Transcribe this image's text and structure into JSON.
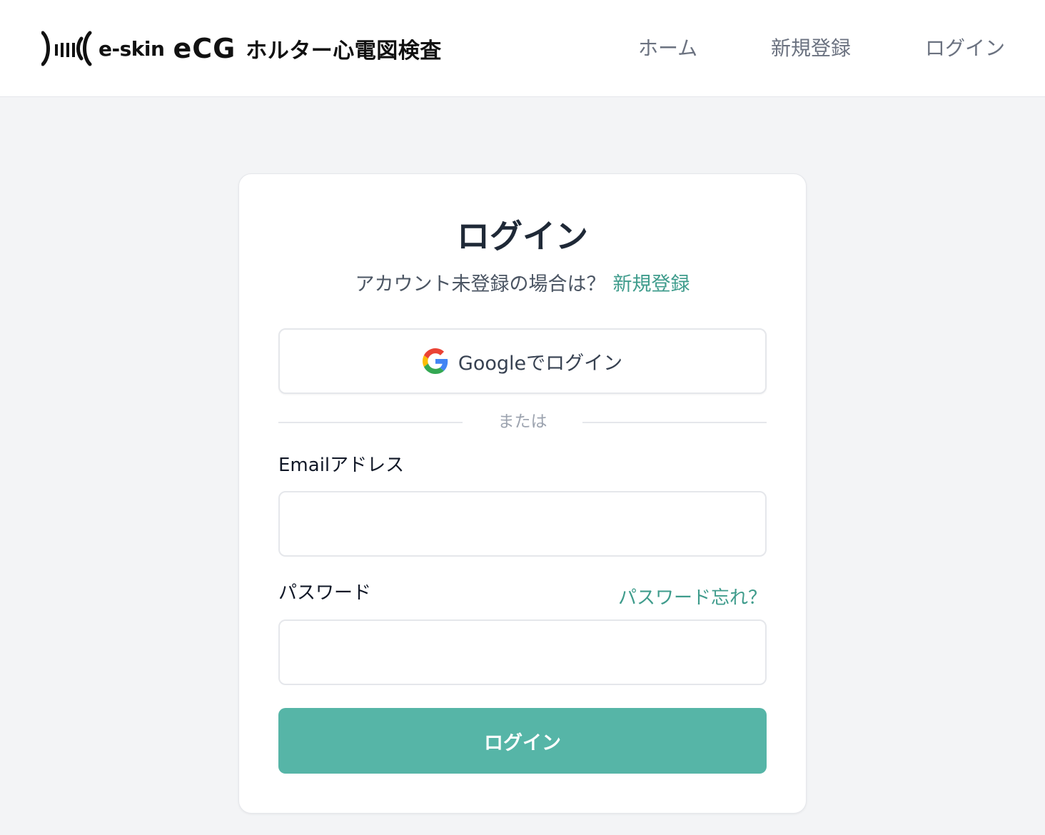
{
  "header": {
    "logo": {
      "brand_small": "e-skin",
      "brand_large": "eCG",
      "title": "ホルター心電図検査"
    },
    "nav": {
      "home": "ホーム",
      "signup": "新規登録",
      "login": "ログイン"
    }
  },
  "login_card": {
    "title": "ログイン",
    "subtitle": "アカウント未登録の場合は？",
    "signup_link": "新規登録",
    "google_button": "Googleでログイン",
    "divider": "または",
    "email_label": "Emailアドレス",
    "email_value": "",
    "password_label": "パスワード",
    "password_value": "",
    "forgot_link": "パスワード忘れ？",
    "submit_button": "ログイン"
  },
  "colors": {
    "accent": "#56b5a7",
    "link": "#3f9c8c",
    "background": "#f3f4f6",
    "nav_text": "#6b7280"
  },
  "icons": {
    "logo_mark": "ecg-wave-icon",
    "google": "google-icon"
  }
}
